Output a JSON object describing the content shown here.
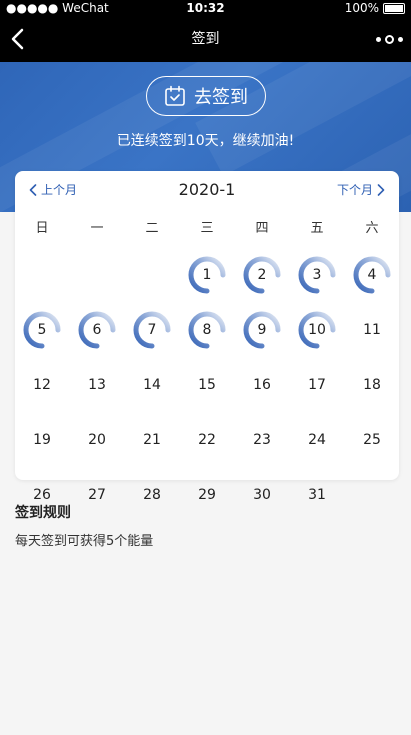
{
  "status_bar": {
    "carrier": "WeChat",
    "time": "10:32",
    "battery": "100%"
  },
  "nav": {
    "title": "签到"
  },
  "banner": {
    "sign_button_label": "去签到",
    "streak_text": "已连续签到10天，继续加油!"
  },
  "calendar": {
    "prev_label": "上个月",
    "next_label": "下个月",
    "month_title": "2020-1",
    "weekdays": [
      "日",
      "一",
      "二",
      "三",
      "四",
      "五",
      "六"
    ],
    "days": [
      "1",
      "2",
      "3",
      "4",
      "5",
      "6",
      "7",
      "8",
      "9",
      "10",
      "11",
      "12",
      "13",
      "14",
      "15",
      "16",
      "17",
      "18",
      "19",
      "20",
      "21",
      "22",
      "23",
      "24",
      "25",
      "26",
      "27",
      "28",
      "29",
      "30",
      "31"
    ],
    "first_weekday_index": 3,
    "signed_days": [
      1,
      2,
      3,
      4,
      5,
      6,
      7,
      8,
      9,
      10
    ]
  },
  "rules": {
    "title": "签到规则",
    "text": "每天签到可获得5个能量"
  },
  "colors": {
    "accent": "#2f5fb3",
    "banner": "#3a74c6"
  },
  "icons": {
    "sign": "calendar-check-icon"
  }
}
